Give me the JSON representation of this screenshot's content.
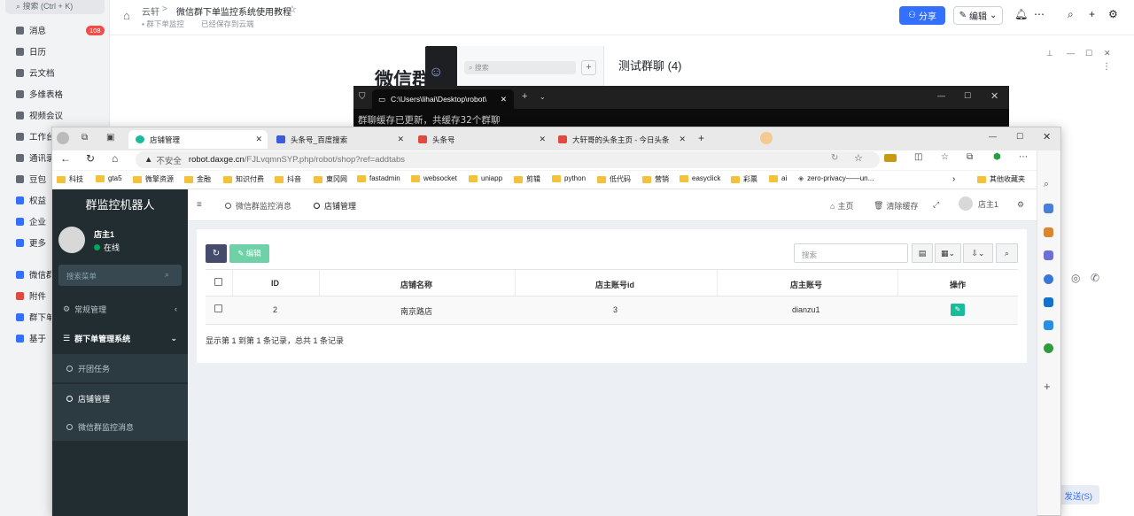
{
  "feishu": {
    "search_placeholder": "搜索 (Ctrl + K)",
    "nav": [
      {
        "label": "消息",
        "badge": "108"
      },
      {
        "label": "日历"
      },
      {
        "label": "云文档"
      },
      {
        "label": "多维表格"
      },
      {
        "label": "视频会议"
      },
      {
        "label": "工作台"
      },
      {
        "label": "通讯录"
      },
      {
        "label": "豆包"
      },
      {
        "label": "权益"
      },
      {
        "label": "企业"
      },
      {
        "label": "更多"
      },
      {
        "label": "微信群"
      },
      {
        "label": "附件"
      },
      {
        "label": "群下单"
      },
      {
        "label": "基于"
      }
    ],
    "breadcrumb_root": "云轩",
    "breadcrumb_sep": ">",
    "doc_title": "微信群下单监控系统使用教程",
    "doc_location": "群下单监控",
    "doc_saved": "已经保存到云端",
    "share_label": "分享",
    "edit_label": "编辑",
    "doc_heading_partial": "微信群",
    "chat_search_placeholder": "搜索",
    "chat_title": "测试群聊 (4)",
    "send_label": "发送(S)",
    "accent": "#3370ff"
  },
  "terminal": {
    "tab_title": "C:\\Users\\lihai\\Desktop\\robot\\",
    "output_line": "群聊缓存已更新，共缓存32个群聊"
  },
  "browser": {
    "tabs": [
      {
        "label": "店铺管理",
        "active": true
      },
      {
        "label": "头条号_百度搜索",
        "active": false
      },
      {
        "label": "头条号",
        "active": false
      },
      {
        "label": "大轩哥的头条主页 - 今日头条",
        "active": false
      }
    ],
    "address": {
      "warning": "不安全",
      "host": "robot.daxge.cn",
      "path": "/FJLvqmnSYP.php/robot/shop?ref=addtabs"
    },
    "bookmarks": [
      "科技",
      "gta5",
      "微擎资源",
      "金融",
      "知识付费",
      "抖音",
      "東冈网",
      "fastadmin",
      "websocket",
      "uniapp",
      "剪辑",
      "python",
      "低代码",
      "营销",
      "easyclick",
      "彩票",
      "ai",
      "zero-privacy——un..."
    ],
    "other_bookmarks": "其他收藏夹"
  },
  "admin": {
    "logo": "群监控机器人",
    "user_name": "店主1",
    "user_status": "在线",
    "search_placeholder": "搜索菜单",
    "menu": {
      "general": "常规管理",
      "group_system": "群下单管理系统",
      "open_task": "开团任务",
      "shop_manage": "店铺管理",
      "wechat_monitor": "微信群监控消息"
    },
    "top_tabs": [
      "微信群监控消息",
      "店铺管理"
    ],
    "top_home": "主页",
    "top_clear_cache": "清除缓存",
    "top_user": "店主1",
    "toolbar": {
      "edit_label": "编辑",
      "search_placeholder": "搜索"
    },
    "table": {
      "headers": [
        "ID",
        "店铺名称",
        "店主账号id",
        "店主账号",
        "操作"
      ],
      "rows": [
        {
          "id": "2",
          "name": "南京路店",
          "owner_id": "3",
          "owner_account": "dianzu1"
        }
      ],
      "info": "显示第 1 到第 1 条记录，总共 1 条记录"
    }
  }
}
